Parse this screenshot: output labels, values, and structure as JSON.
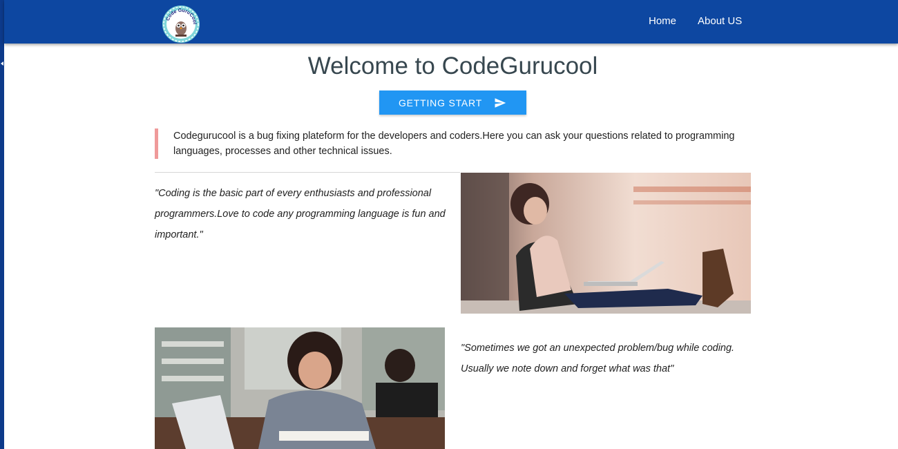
{
  "navbar": {
    "logo_text": "Code GuruCool",
    "links": [
      {
        "label": "Home"
      },
      {
        "label": "About US"
      }
    ]
  },
  "hero": {
    "title": "Welcome to CodeGurucool",
    "cta_label": "GETTING START"
  },
  "intro": {
    "text": "Codegurucool is a bug fixing plateform for the developers and coders.Here you can ask your questions related to programming languages, processes and other technical issues."
  },
  "features": [
    {
      "quote": "\"Coding is the basic part of every enthusiasts and professional programmers.Love to code any programming language is fun and important.\""
    },
    {
      "quote": "\"Sometimes we got an unexpected problem/bug while coding. Usually we note down and forget what was that\""
    }
  ],
  "colors": {
    "navbar": "#0d47a1",
    "button": "#2196f3",
    "quote_border": "#ef9a9a",
    "title": "#37474f"
  }
}
